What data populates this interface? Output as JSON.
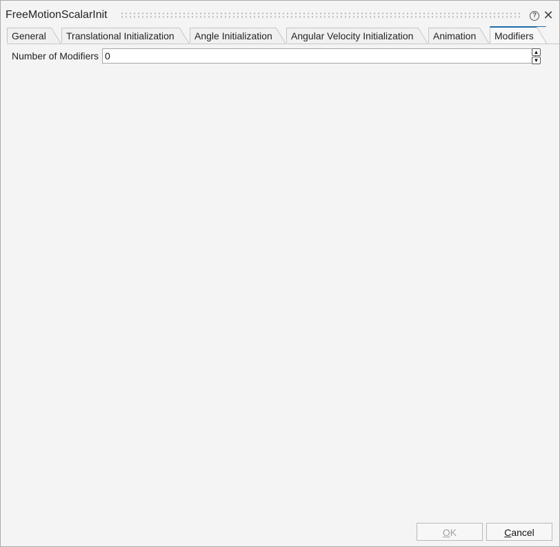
{
  "window": {
    "title": "FreeMotionScalarInit",
    "help_icon": "question-circle-icon",
    "close_icon": "close-x-icon"
  },
  "tabs": [
    {
      "label": "General",
      "active": false
    },
    {
      "label": "Translational Initialization",
      "active": false
    },
    {
      "label": "Angle Initialization",
      "active": false
    },
    {
      "label": "Angular Velocity Initialization",
      "active": false
    },
    {
      "label": "Animation",
      "active": false
    },
    {
      "label": "Modifiers",
      "active": true
    }
  ],
  "modifiers": {
    "number_label": "Number of Modifiers",
    "number_value": "0"
  },
  "buttons": {
    "ok_first": "O",
    "ok_rest": "K",
    "ok_enabled": false,
    "cancel_first": "C",
    "cancel_rest": "ancel"
  },
  "colors": {
    "active_tab_accent": "#1e6aa8",
    "background": "#f4f4f4"
  }
}
